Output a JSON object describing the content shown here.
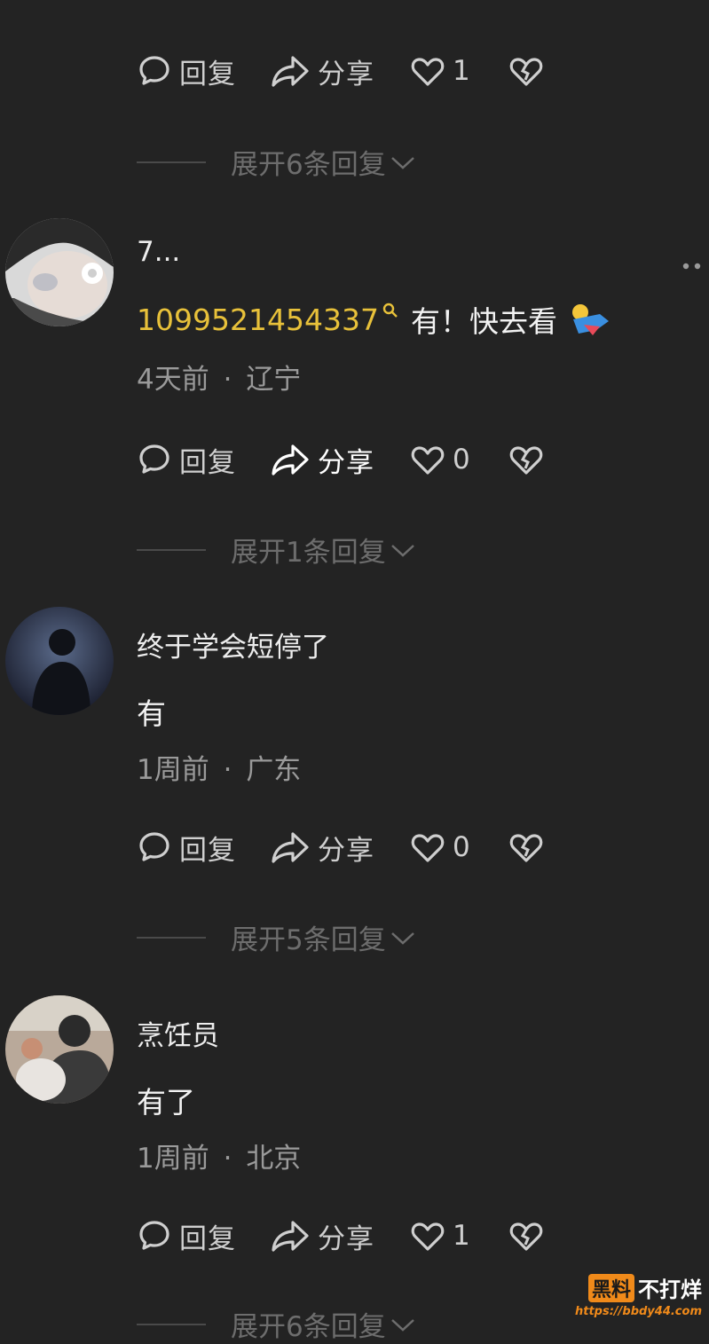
{
  "comments": [
    {
      "actions": {
        "reply_label": "回复",
        "share_label": "分享",
        "likes": "1"
      },
      "expand_label": "展开6条回复"
    },
    {
      "username": "7...",
      "mention": "1099521454337",
      "text": "有！快去看",
      "time": "4天前",
      "location": "辽宁",
      "actions": {
        "reply_label": "回复",
        "share_label": "分享",
        "likes": "0"
      },
      "expand_label": "展开1条回复"
    },
    {
      "username": "终于学会短停了",
      "text": "有",
      "time": "1周前",
      "location": "广东",
      "actions": {
        "reply_label": "回复",
        "share_label": "分享",
        "likes": "0"
      },
      "expand_label": "展开5条回复"
    },
    {
      "username": "烹饪员",
      "text": "有了",
      "time": "1周前",
      "location": "北京",
      "actions": {
        "reply_label": "回复",
        "share_label": "分享",
        "likes": "1"
      },
      "expand_label": "展开6条回复"
    }
  ],
  "meta_separator": "·",
  "watermark": {
    "brand": "黑料",
    "tagline": "不打烊",
    "url": "https://bbdy44.com"
  },
  "colors": {
    "background": "#232323",
    "mention": "#e8c13a",
    "muted": "#6d6d6d"
  }
}
